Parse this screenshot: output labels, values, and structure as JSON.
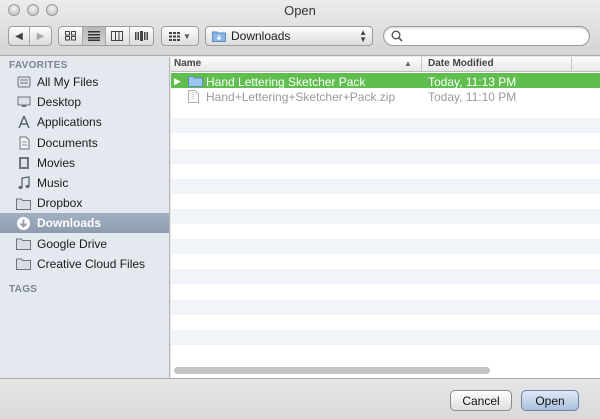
{
  "window": {
    "title": "Open"
  },
  "toolbar": {
    "back_icon": "back-arrow-icon",
    "forward_icon": "forward-arrow-icon",
    "path_label": "Downloads",
    "search_value": "",
    "search_placeholder": ""
  },
  "sidebar": {
    "favorites_heading": "FAVORITES",
    "tags_heading": "TAGS",
    "items": [
      {
        "label": "All My Files",
        "icon": "all-files-icon",
        "selected": false
      },
      {
        "label": "Desktop",
        "icon": "desktop-icon",
        "selected": false
      },
      {
        "label": "Applications",
        "icon": "applications-icon",
        "selected": false
      },
      {
        "label": "Documents",
        "icon": "documents-icon",
        "selected": false
      },
      {
        "label": "Movies",
        "icon": "movies-icon",
        "selected": false
      },
      {
        "label": "Music",
        "icon": "music-icon",
        "selected": false
      },
      {
        "label": "Dropbox",
        "icon": "folder-icon",
        "selected": false
      },
      {
        "label": "Downloads",
        "icon": "downloads-icon",
        "selected": true
      },
      {
        "label": "Google Drive",
        "icon": "folder-icon",
        "selected": false
      },
      {
        "label": "Creative Cloud Files",
        "icon": "folder-icon",
        "selected": false
      }
    ]
  },
  "filelist": {
    "col_name": "Name",
    "col_date": "Date Modified",
    "rows": [
      {
        "name": "Hand Lettering Sketcher Pack",
        "date": "Today, 11:13 PM",
        "kind": "folder",
        "selected": true
      },
      {
        "name": "Hand+Lettering+Sketcher+Pack.zip",
        "date": "Today, 11:10 PM",
        "kind": "zip",
        "selected": false
      }
    ]
  },
  "buttons": {
    "cancel": "Cancel",
    "open": "Open"
  },
  "colors": {
    "selection_green": "#5fbe4e",
    "sidebar_selection": "#95a3b8"
  }
}
